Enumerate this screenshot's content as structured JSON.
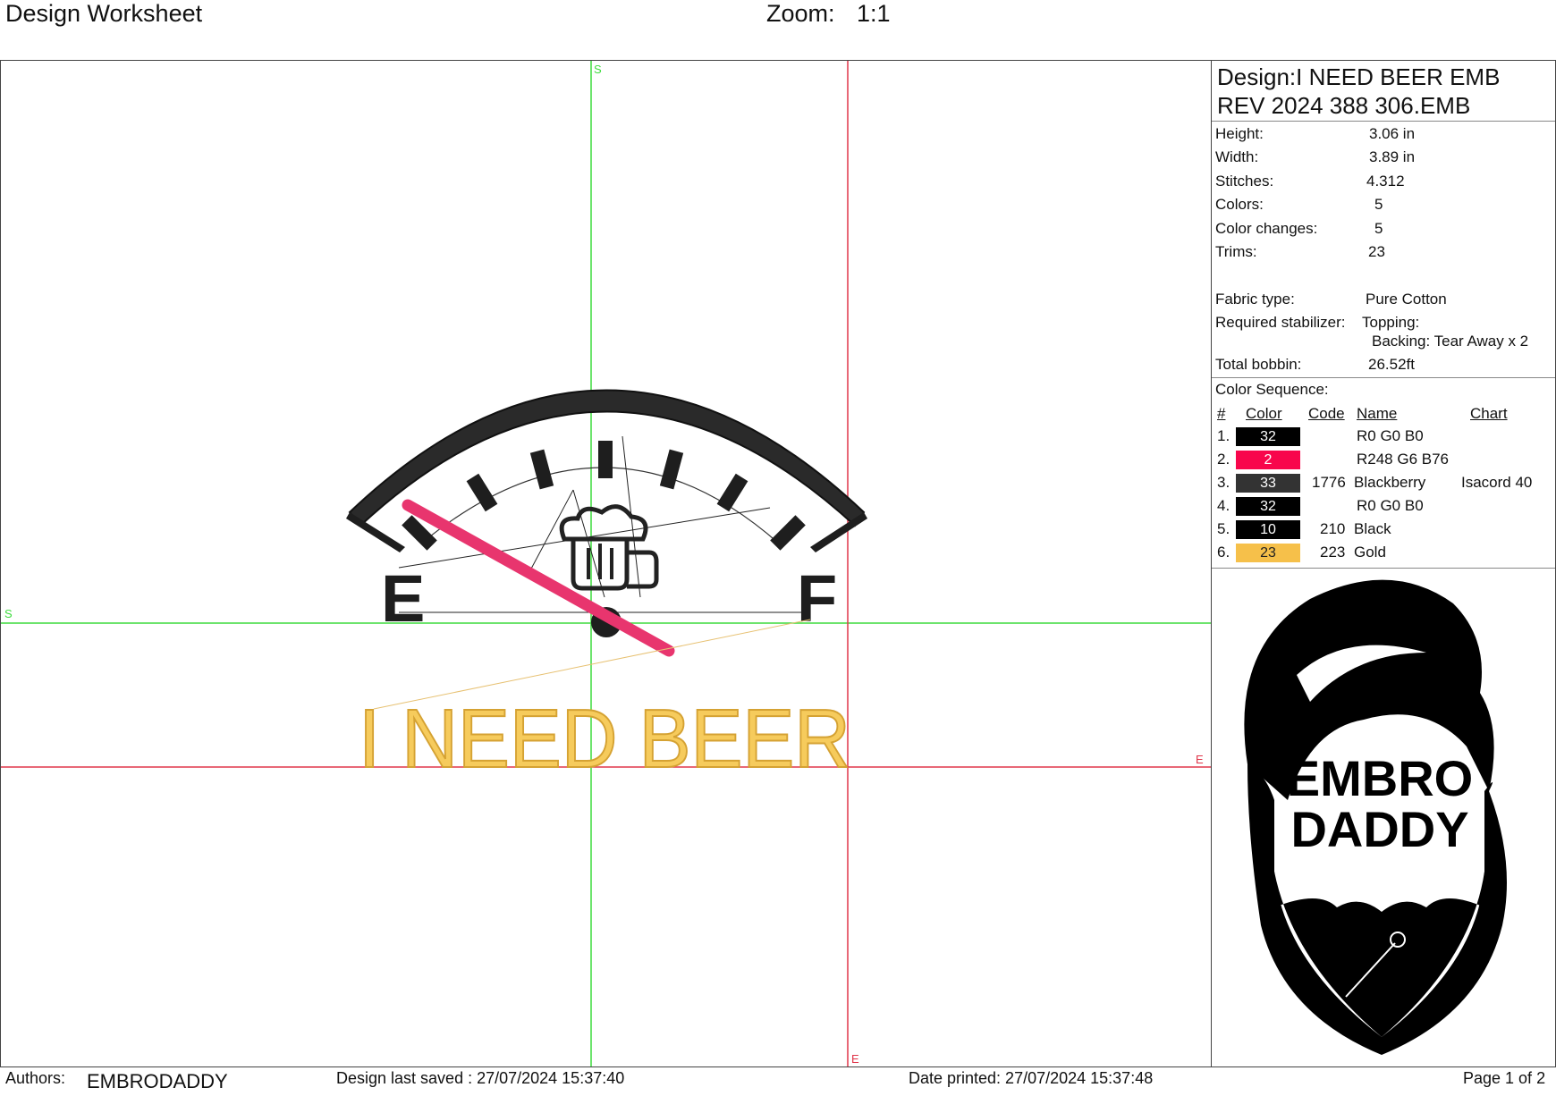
{
  "header": {
    "title": "Design Worksheet",
    "zoom_label": "Zoom:",
    "zoom_value": "1:1"
  },
  "canvas": {
    "axis_start": "S",
    "axis_end": "E",
    "text_design": "I NEED BEER",
    "gauge_empty": "E",
    "gauge_full": "F",
    "colors": {
      "guide_green": "#3ddc3d",
      "guide_red": "#e0364a",
      "black_thread": "#1a1a1a",
      "needle": "#e8356e",
      "gold_fill": "#f6cb5c",
      "gold_stroke": "#d5a233"
    }
  },
  "info": {
    "design_line1": "Design:I NEED BEER EMB",
    "design_line2": "REV 2024 388 306.EMB",
    "props": [
      {
        "label": "Height:",
        "value": "3.06 in"
      },
      {
        "label": "Width:",
        "value": "3.89 in"
      },
      {
        "label": "Stitches:",
        "value": "4.312"
      },
      {
        "label": "Colors:",
        "value": "5"
      },
      {
        "label": "Color changes:",
        "value": "5"
      },
      {
        "label": "Trims:",
        "value": "23"
      }
    ],
    "fabric_label": "Fabric type:",
    "fabric_value": "Pure Cotton",
    "stabilizer_label": "Required stabilizer:",
    "stabilizer_topping": "Topping:",
    "stabilizer_backing": "Backing: Tear Away x 2",
    "bobbin_label": "Total bobbin:",
    "bobbin_value": "26.52ft"
  },
  "color_sequence": {
    "title": "Color Sequence:",
    "headers": {
      "num": "#",
      "color": "Color",
      "code": "Code",
      "name": "Name",
      "chart": "Chart"
    },
    "rows": [
      {
        "num": "1.",
        "swatch": "32",
        "hex": "#000000",
        "code": "",
        "name": "R0 G0 B0",
        "chart": ""
      },
      {
        "num": "2.",
        "swatch": "2",
        "hex": "#f8064c",
        "code": "",
        "name": "R248 G6 B76",
        "chart": ""
      },
      {
        "num": "3.",
        "swatch": "33",
        "hex": "#333333",
        "code": "1776",
        "name": "Blackberry",
        "chart": "Isacord 40"
      },
      {
        "num": "4.",
        "swatch": "32",
        "hex": "#000000",
        "code": "",
        "name": "R0 G0 B0",
        "chart": ""
      },
      {
        "num": "5.",
        "swatch": "10",
        "hex": "#000000",
        "code": "210",
        "name": "Black",
        "chart": ""
      },
      {
        "num": "6.",
        "swatch": "23",
        "hex": "#f6c04a",
        "code": "223",
        "name": "Gold",
        "chart": ""
      }
    ]
  },
  "logo": {
    "line1": "EMBRO",
    "line2": "DADDY"
  },
  "footer": {
    "authors_label": "Authors:",
    "authors_value": "EMBRODADDY",
    "saved": "Design last saved : 27/07/2024 15:37:40",
    "printed": "Date printed: 27/07/2024 15:37:48",
    "page": "Page 1 of 2"
  }
}
